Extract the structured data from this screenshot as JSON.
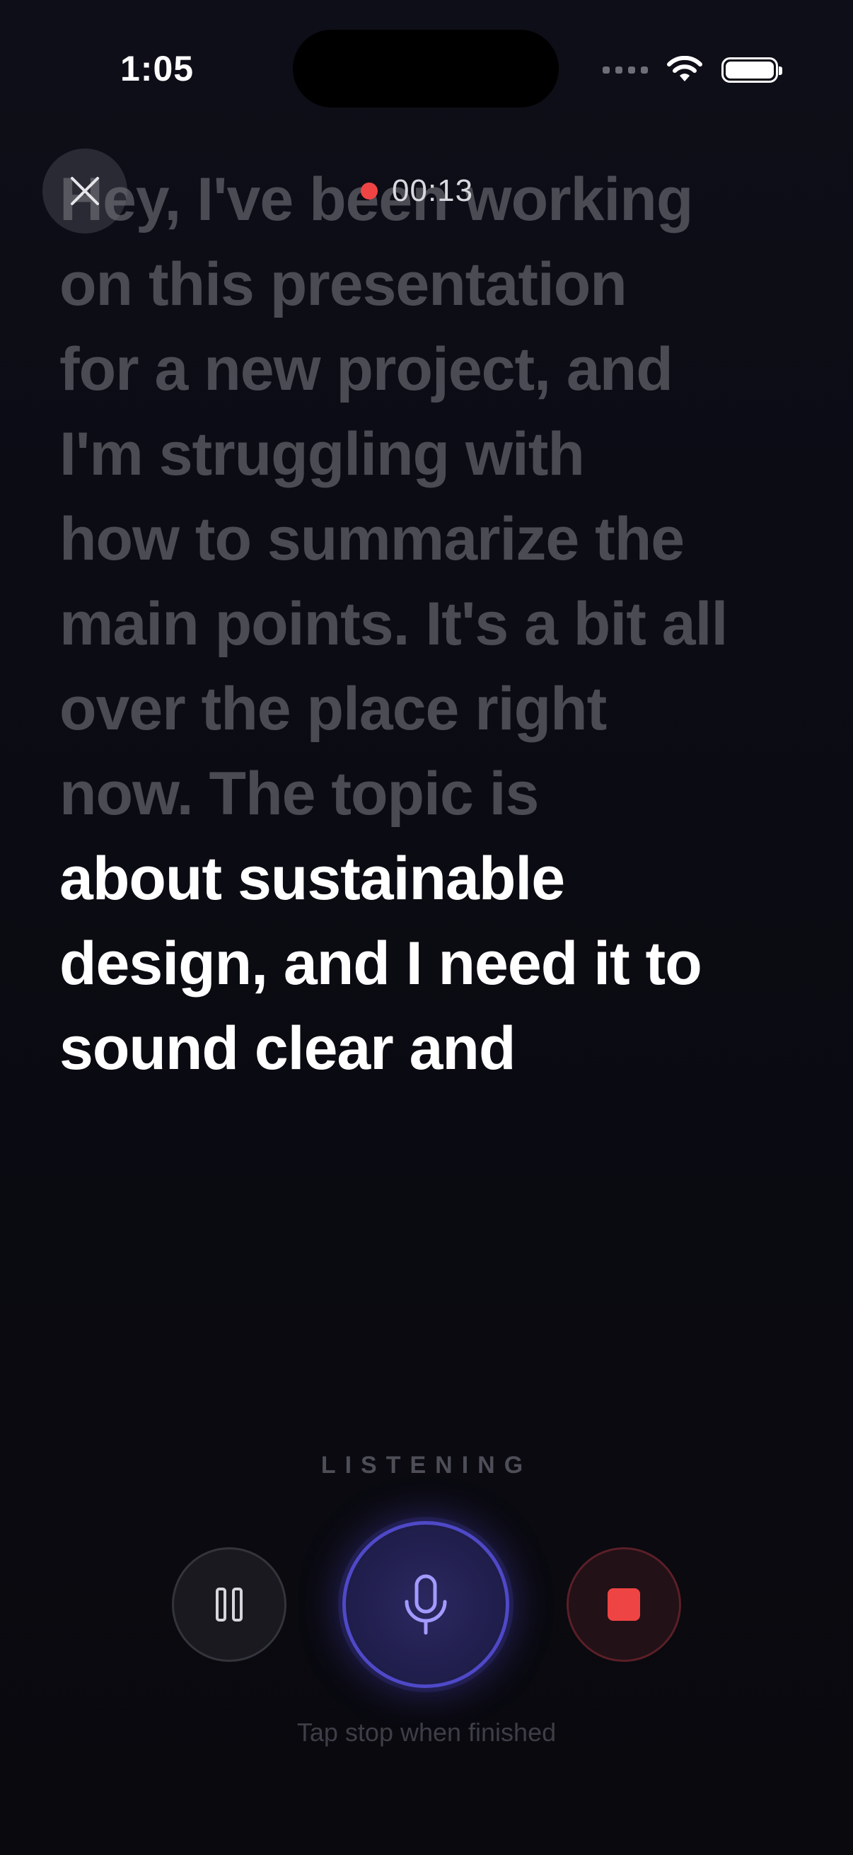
{
  "status_bar": {
    "time": "1:05"
  },
  "header": {
    "timer": "00:13"
  },
  "transcript": {
    "past_lines": [
      "Hey, I've been working",
      "on this presentation",
      "for a new project, and",
      "I'm struggling with",
      "how to summarize the",
      "main points. It's a bit all",
      "over the place right",
      "now. The topic is"
    ],
    "current_lines": [
      "about sustainable",
      "design, and I need it to",
      "sound clear and"
    ]
  },
  "controls": {
    "status_label": "LISTENING",
    "hint": "Tap stop when finished"
  },
  "colors": {
    "accent": "#4f49c8",
    "record": "#ef4444",
    "past_text": "#4b4b53",
    "current_text": "#ffffff"
  }
}
